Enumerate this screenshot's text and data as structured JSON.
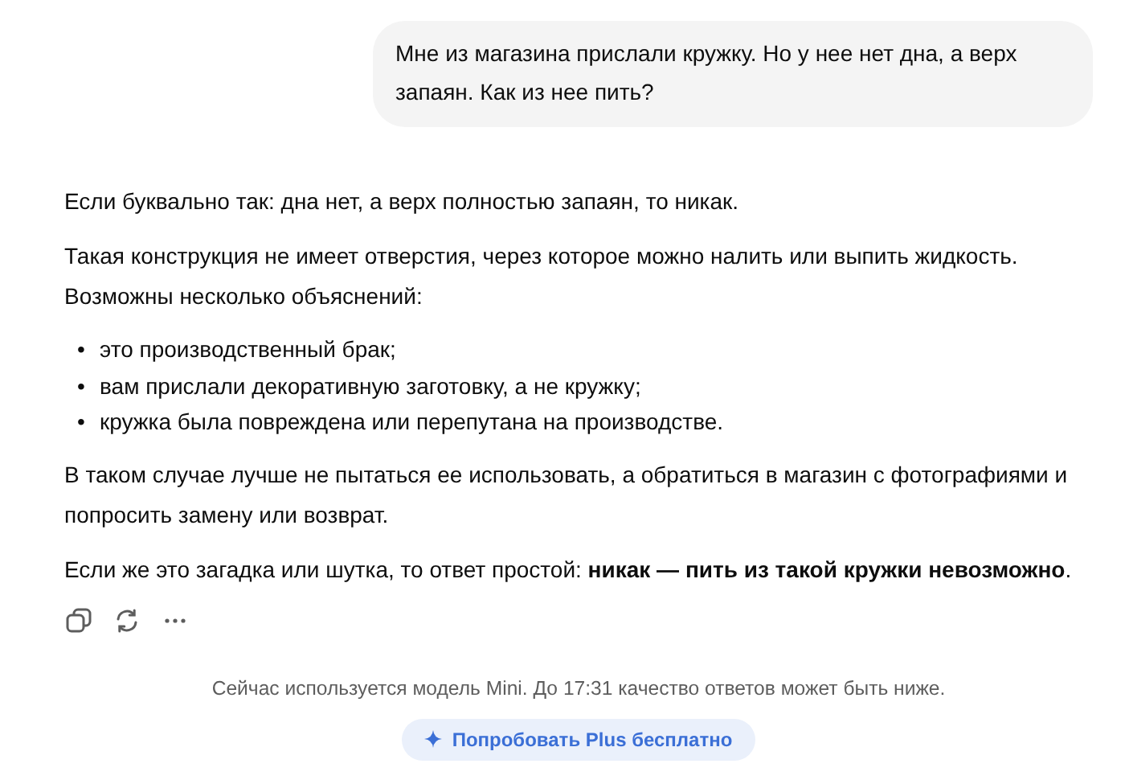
{
  "user_message": {
    "text": "Мне из магазина прислали кружку. Но у нее нет дна, а верх запаян. Как из нее пить?"
  },
  "answer": [
    {
      "kind": "paragraph",
      "text": "Если буквально так: дна нет, а верх полностью запаян, то никак."
    },
    {
      "kind": "paragraph",
      "text": "Такая конструкция не имеет отверстия, через которое можно налить или выпить жидкость. Возможны несколько объяснений:"
    },
    {
      "kind": "list",
      "items": [
        {
          "bullet": "•",
          "text": "это производственный брак;"
        },
        {
          "bullet": "•",
          "text": "вам прислали декоративную заготовку, а не кружку;"
        },
        {
          "bullet": "•",
          "text": "кружка была повреждена или перепутана на производстве."
        }
      ]
    },
    {
      "kind": "paragraph",
      "text": "В таком случае лучше не пытаться ее использовать, а обратиться в магазин с фотографиями и попросить замену или возврат."
    },
    {
      "kind": "paragraph",
      "text": "Если же это загадка или шутка, то ответ простой: **никак — пить из такой кружки невозможно**."
    }
  ],
  "actions": [
    {
      "kind": "copy"
    },
    {
      "kind": "regenerate"
    },
    {
      "kind": "more"
    }
  ],
  "notice": "Сейчас используется модель Mini. До 17:31 качество ответов может быть ниже.",
  "upgrade_button": {
    "label": "Попробовать Plus бесплатно"
  }
}
